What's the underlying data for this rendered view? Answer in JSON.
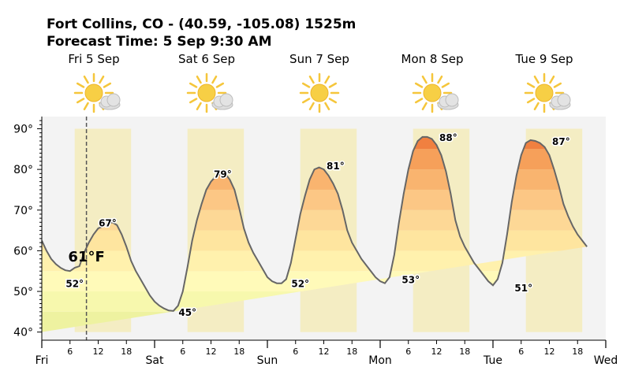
{
  "header": {
    "title_line1": "Fort Collins, CO - (40.59, -105.08) 1525m",
    "title_line2": "Forecast Time: 5 Sep 9:30 AM"
  },
  "days": [
    {
      "label": "Fri 5 Sep",
      "icon": "partly-sunny-icon"
    },
    {
      "label": "Sat 6 Sep",
      "icon": "partly-sunny-icon"
    },
    {
      "label": "Sun 7 Sep",
      "icon": "sunny-icon"
    },
    {
      "label": "Mon 8 Sep",
      "icon": "partly-sunny-icon"
    },
    {
      "label": "Tue 9 Sep",
      "icon": "partly-sunny-icon"
    }
  ],
  "current": {
    "temp_label": "61°F",
    "hour": 9.5
  },
  "chart_data": {
    "type": "area",
    "unit": "°F",
    "ylim": [
      38,
      93
    ],
    "xlim_hours": [
      0,
      120
    ],
    "yticks": [
      40,
      50,
      60,
      70,
      80,
      90
    ],
    "ytick_labels": [
      "40°",
      "50°",
      "60°",
      "70°",
      "80°",
      "90°"
    ],
    "day_labels": [
      "Fri",
      "Sat",
      "Sun",
      "Mon",
      "Tue",
      "Wed"
    ],
    "hour_labels": [
      "6",
      "12",
      "18"
    ],
    "daylight_hours": [
      [
        7,
        19
      ],
      [
        31,
        43
      ],
      [
        55,
        67
      ],
      [
        79,
        91
      ],
      [
        103,
        115
      ]
    ],
    "annotations": [
      {
        "hour": 7,
        "value": 52,
        "label": "52°"
      },
      {
        "hour": 14,
        "value": 67,
        "label": "67°"
      },
      {
        "hour": 31,
        "value": 45,
        "label": "45°"
      },
      {
        "hour": 38.5,
        "value": 79,
        "label": "79°"
      },
      {
        "hour": 55,
        "value": 52,
        "label": "52°"
      },
      {
        "hour": 62.5,
        "value": 81,
        "label": "81°"
      },
      {
        "hour": 78.5,
        "value": 53,
        "label": "53°"
      },
      {
        "hour": 86.5,
        "value": 88,
        "label": "88°"
      },
      {
        "hour": 102.5,
        "value": 51,
        "label": "51°"
      },
      {
        "hour": 110.5,
        "value": 87,
        "label": "87°"
      }
    ],
    "series": [
      {
        "hours": [
          0,
          1,
          2,
          3,
          4,
          5,
          6,
          7,
          8,
          9,
          10,
          11,
          12,
          13,
          14,
          15,
          16,
          17,
          18,
          19,
          20,
          21,
          22,
          23,
          24,
          25,
          26,
          27,
          28,
          29,
          30,
          31,
          32,
          33,
          34,
          35,
          36,
          37,
          38,
          39,
          40,
          41,
          42,
          43,
          44,
          45,
          46,
          47,
          48,
          49,
          50,
          51,
          52,
          53,
          54,
          55,
          56,
          57,
          58,
          59,
          60,
          61,
          62,
          63,
          64,
          65,
          66,
          67,
          68,
          69,
          70,
          71,
          72,
          73,
          74,
          75,
          76,
          77,
          78,
          79,
          80,
          81,
          82,
          83,
          84,
          85,
          86,
          87,
          88,
          89,
          90,
          91,
          92,
          93,
          94,
          95,
          96,
          97,
          98,
          99,
          100,
          101,
          102,
          103,
          104,
          105,
          106,
          107,
          108,
          109,
          110,
          111,
          112,
          113,
          114,
          115,
          116,
          117,
          118,
          119,
          120
        ],
        "values": [
          62.5,
          60,
          58,
          56.7,
          55.8,
          55.2,
          55,
          55.8,
          56.2,
          59.5,
          62,
          64,
          65.5,
          66,
          66.5,
          67,
          66.3,
          64,
          61,
          57.5,
          55,
          53,
          51,
          49,
          47.5,
          46.5,
          45.8,
          45.3,
          45.2,
          46.5,
          50,
          56,
          62.5,
          67.5,
          71.5,
          75,
          77,
          78.3,
          78.8,
          79,
          77.5,
          75,
          70.5,
          65.5,
          62,
          59.5,
          57.5,
          55.5,
          53.5,
          52.5,
          52,
          52,
          53,
          57,
          63,
          69,
          73.5,
          77.5,
          80,
          80.5,
          80,
          78.5,
          76.5,
          74,
          70,
          65,
          62,
          60,
          58,
          56.5,
          55,
          53.5,
          52.5,
          52,
          53.5,
          59,
          67,
          74,
          80,
          84.5,
          87,
          88,
          88,
          87.5,
          86,
          83.5,
          79.5,
          74,
          67.5,
          63.5,
          61,
          59,
          57,
          55.5,
          54,
          52.5,
          51.5,
          53,
          57,
          64,
          72,
          78.5,
          83.5,
          86.5,
          87.2,
          87,
          86.5,
          85.5,
          83.5,
          80,
          76,
          71.5,
          68.5,
          66,
          64,
          62.5,
          61
        ]
      }
    ]
  }
}
